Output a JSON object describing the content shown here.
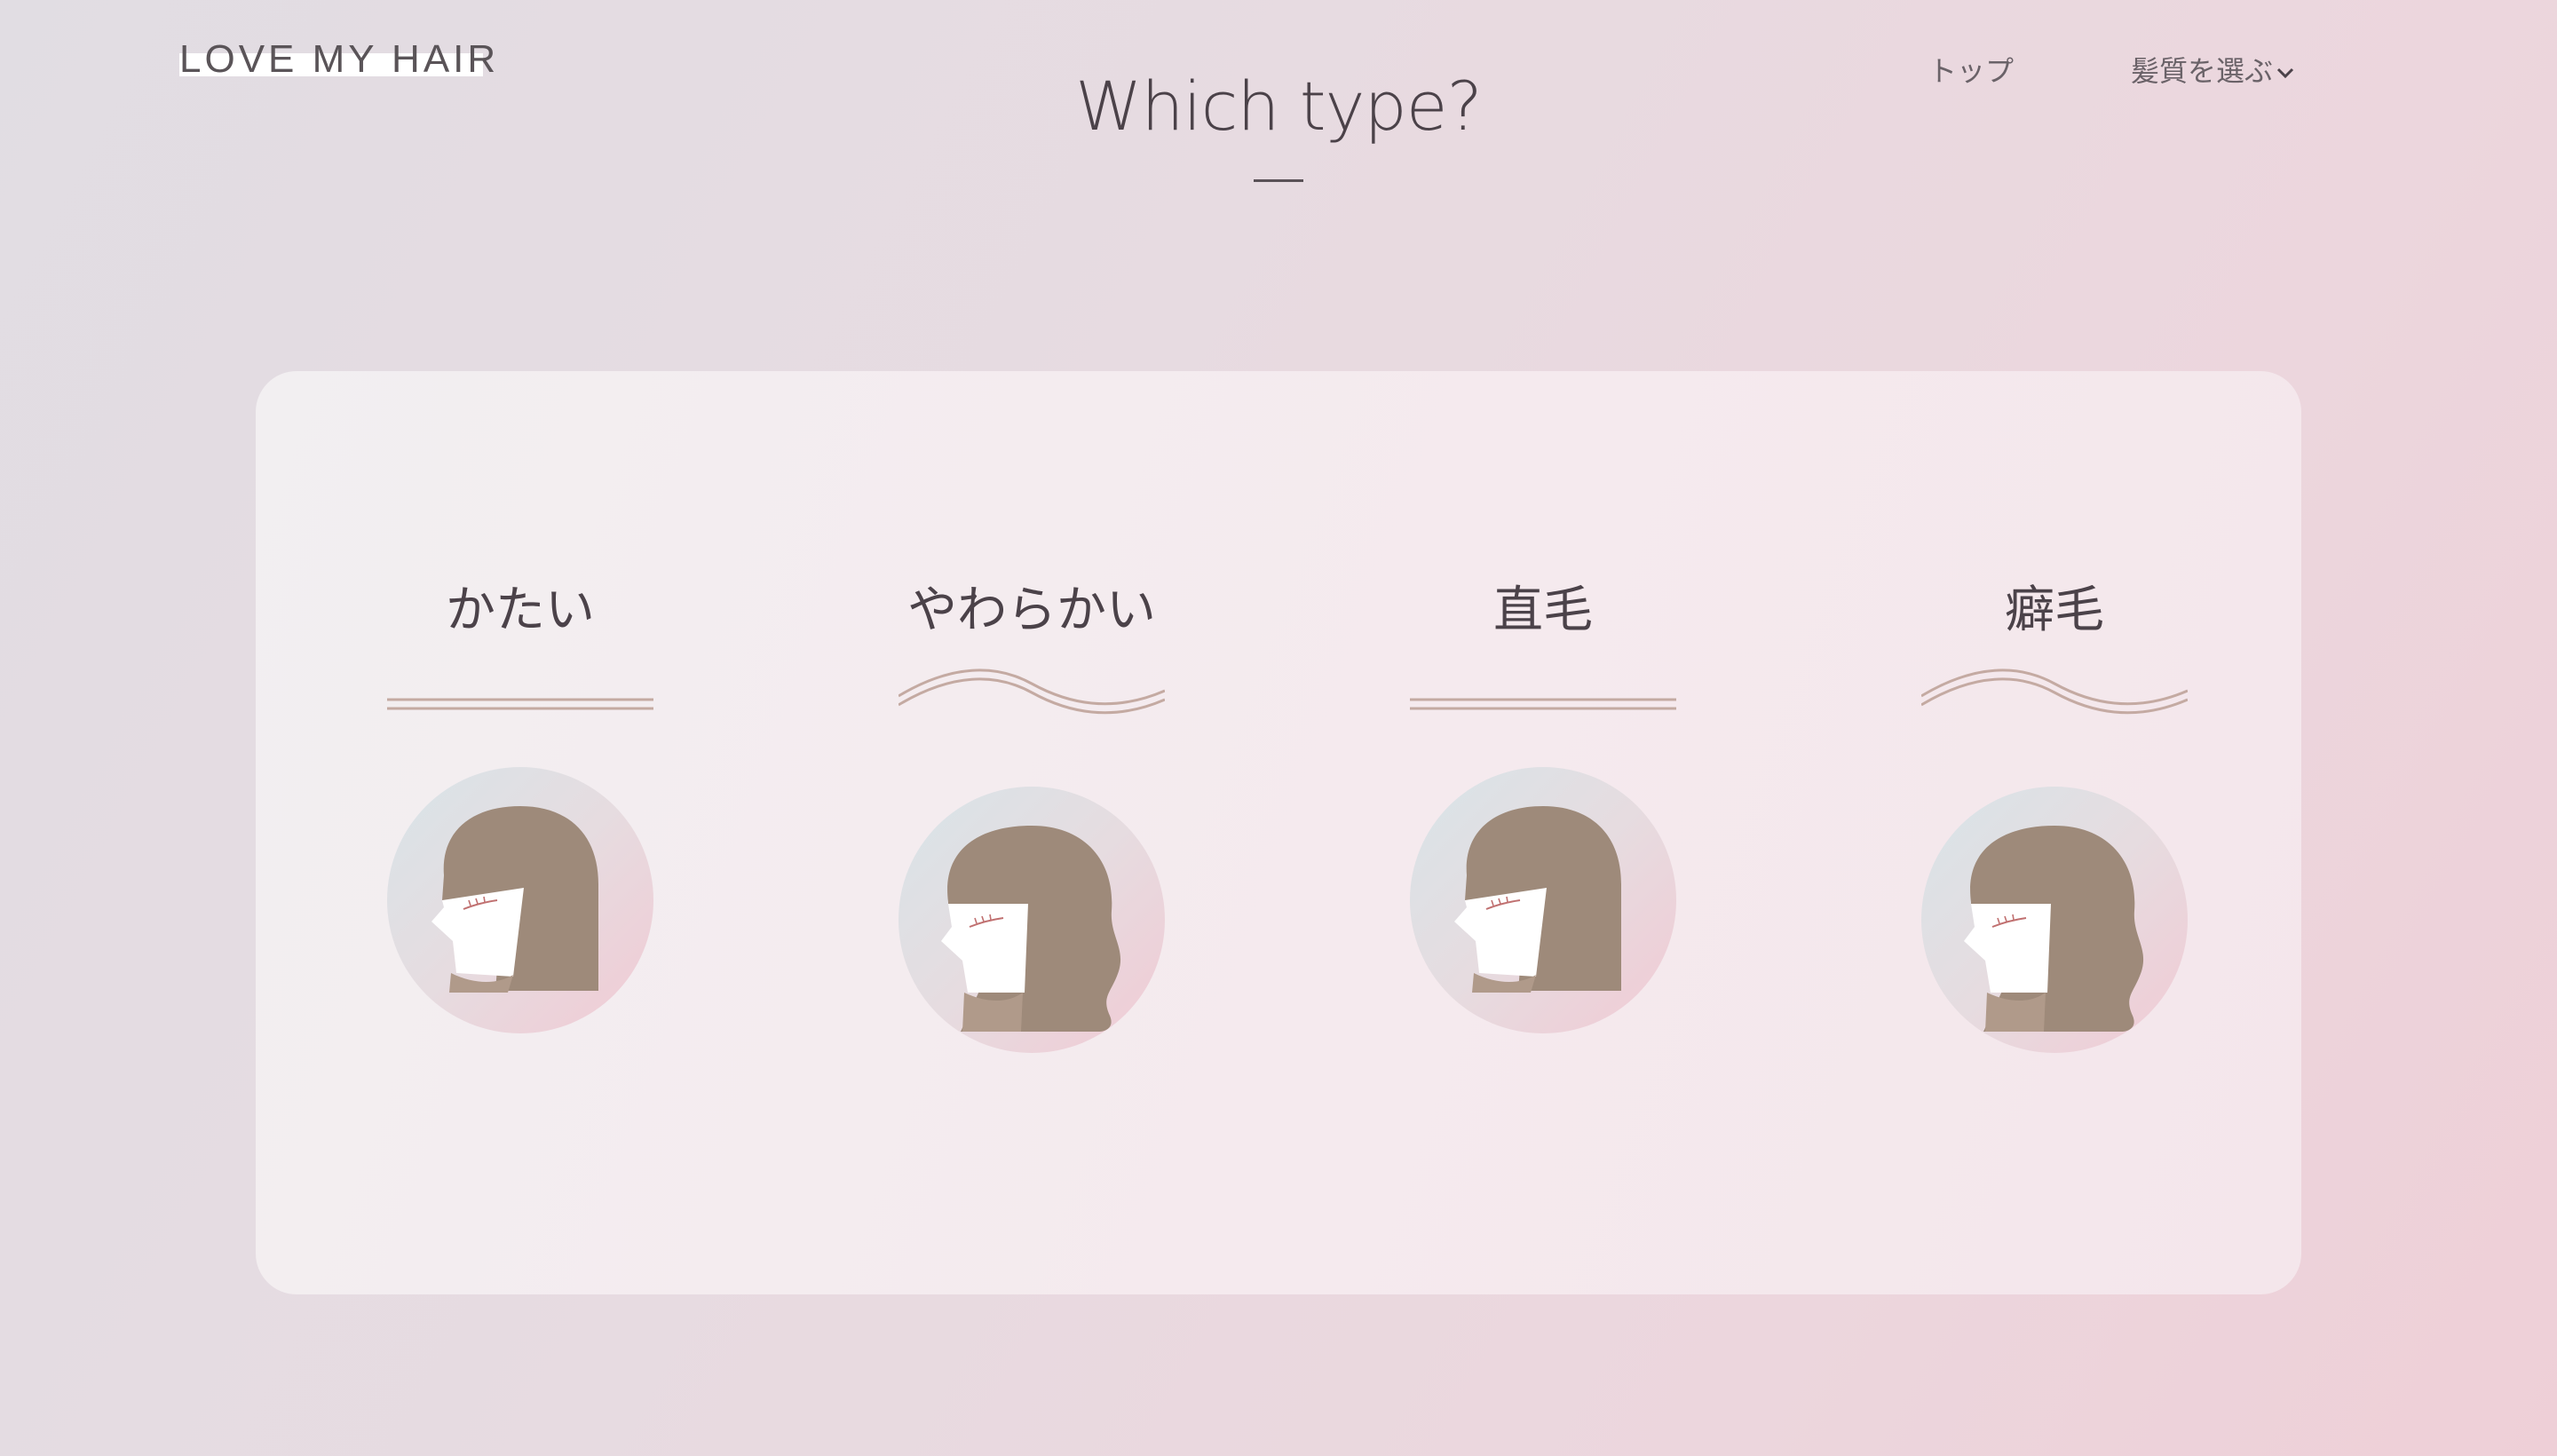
{
  "header": {
    "logo": "LOVE MY HAIR",
    "title": "Which type?",
    "nav": {
      "top": "トップ",
      "select": "髪質を選ぶ"
    }
  },
  "cards": [
    {
      "label": "かたい",
      "line": "straight",
      "hair": "straight"
    },
    {
      "label": "やわらかい",
      "line": "wavy",
      "hair": "wavy"
    },
    {
      "label": "直毛",
      "line": "straight",
      "hair": "straight"
    },
    {
      "label": "癖毛",
      "line": "wavy",
      "hair": "wavy"
    }
  ],
  "colors": {
    "hair": "#9e8a7a",
    "hair_shadow": "#b09a8a",
    "line": "#c4aaa2",
    "text": "#4b4249",
    "panel": "#f4edf0"
  }
}
